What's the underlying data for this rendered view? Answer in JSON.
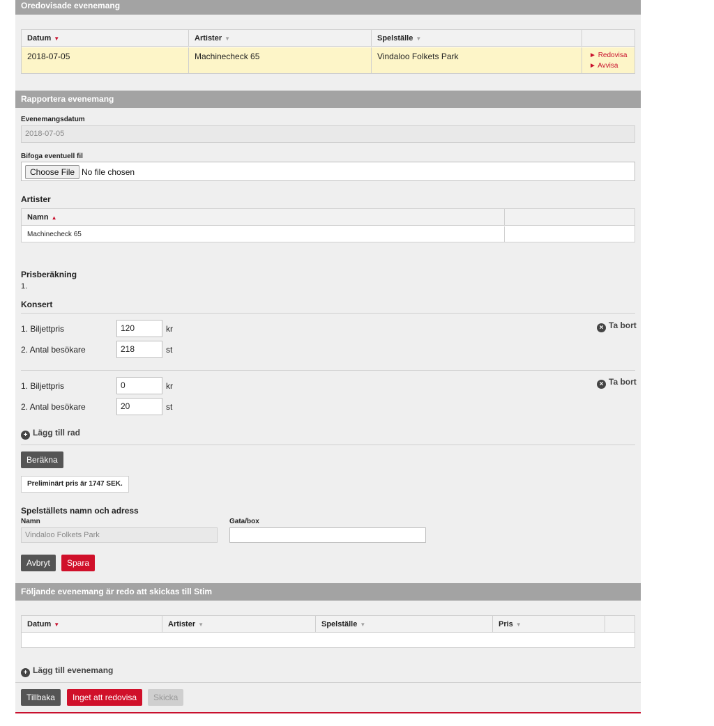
{
  "unreported": {
    "title": "Oredovisade evenemang",
    "headers": [
      "Datum",
      "Artister",
      "Spelställe"
    ],
    "row": {
      "date": "2018-07-05",
      "artist": "Machinecheck 65",
      "venue": "Vindaloo Folkets Park",
      "action_report": "Redovisa",
      "action_reject": "Avvisa"
    }
  },
  "report": {
    "title": "Rapportera evenemang",
    "date_label": "Evenemangsdatum",
    "date_value": "2018-07-05",
    "file_label": "Bifoga eventuell fil",
    "file_button": "Choose File",
    "file_status": "No file chosen",
    "artists_heading": "Artister",
    "artists_header": "Namn",
    "artists": [
      "Machinecheck 65"
    ]
  },
  "pricing": {
    "heading": "Prisberäkning",
    "number": "1.",
    "type": "Konsert",
    "rows": [
      {
        "price_label": "1. Biljettpris",
        "price": "120",
        "price_unit": "kr",
        "visitors_label": "2. Antal besökare",
        "visitors": "218",
        "visitors_unit": "st",
        "remove": "Ta bort"
      },
      {
        "price_label": "1. Biljettpris",
        "price": "0",
        "price_unit": "kr",
        "visitors_label": "2. Antal besökare",
        "visitors": "20",
        "visitors_unit": "st",
        "remove": "Ta bort"
      }
    ],
    "add_row": "Lägg till rad",
    "calculate": "Beräkna",
    "result": "Preliminärt pris är 1747 SEK."
  },
  "venue": {
    "heading": "Spelställets namn och adress",
    "name_label": "Namn",
    "name_value": "Vindaloo Folkets Park",
    "street_label": "Gata/box",
    "street_value": "",
    "cancel": "Avbryt",
    "save": "Spara"
  },
  "ready": {
    "title": "Följande evenemang är redo att skickas till Stim",
    "headers": [
      "Datum",
      "Artister",
      "Spelställe",
      "Pris"
    ],
    "add_event": "Lägg till evenemang"
  },
  "footer": {
    "back": "Tillbaka",
    "nothing": "Inget att redovisa",
    "send": "Skicka"
  },
  "colors": {
    "accent": "#c8102e",
    "header_bg": "#a3a3a3",
    "highlight_row": "#fdf5c8"
  }
}
